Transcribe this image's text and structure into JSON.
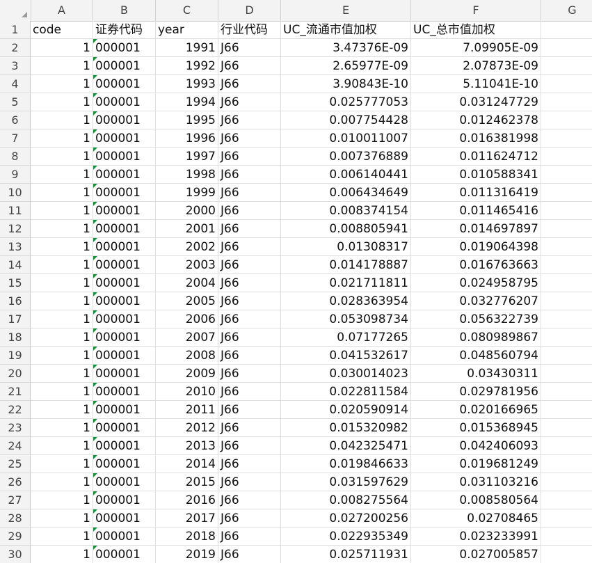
{
  "columns": [
    "A",
    "B",
    "C",
    "D",
    "E",
    "F",
    "G"
  ],
  "headers": [
    "code",
    "证券代码",
    "year",
    "行业代码",
    "UC_流通市值加权",
    "UC_总市值加权"
  ],
  "rows": [
    [
      "1",
      "000001",
      "1991",
      "J66",
      "3.47376E-09",
      "7.09905E-09"
    ],
    [
      "1",
      "000001",
      "1992",
      "J66",
      "2.65977E-09",
      "2.07873E-09"
    ],
    [
      "1",
      "000001",
      "1993",
      "J66",
      "3.90843E-10",
      "5.11041E-10"
    ],
    [
      "1",
      "000001",
      "1994",
      "J66",
      "0.025777053",
      "0.031247729"
    ],
    [
      "1",
      "000001",
      "1995",
      "J66",
      "0.007754428",
      "0.012462378"
    ],
    [
      "1",
      "000001",
      "1996",
      "J66",
      "0.010011007",
      "0.016381998"
    ],
    [
      "1",
      "000001",
      "1997",
      "J66",
      "0.007376889",
      "0.011624712"
    ],
    [
      "1",
      "000001",
      "1998",
      "J66",
      "0.006140441",
      "0.010588341"
    ],
    [
      "1",
      "000001",
      "1999",
      "J66",
      "0.006434649",
      "0.011316419"
    ],
    [
      "1",
      "000001",
      "2000",
      "J66",
      "0.008374154",
      "0.011465416"
    ],
    [
      "1",
      "000001",
      "2001",
      "J66",
      "0.008805941",
      "0.014697897"
    ],
    [
      "1",
      "000001",
      "2002",
      "J66",
      "0.01308317",
      "0.019064398"
    ],
    [
      "1",
      "000001",
      "2003",
      "J66",
      "0.014178887",
      "0.016763663"
    ],
    [
      "1",
      "000001",
      "2004",
      "J66",
      "0.021711811",
      "0.024958795"
    ],
    [
      "1",
      "000001",
      "2005",
      "J66",
      "0.028363954",
      "0.032776207"
    ],
    [
      "1",
      "000001",
      "2006",
      "J66",
      "0.053098734",
      "0.056322739"
    ],
    [
      "1",
      "000001",
      "2007",
      "J66",
      "0.07177265",
      "0.080989867"
    ],
    [
      "1",
      "000001",
      "2008",
      "J66",
      "0.041532617",
      "0.048560794"
    ],
    [
      "1",
      "000001",
      "2009",
      "J66",
      "0.030014023",
      "0.03430311"
    ],
    [
      "1",
      "000001",
      "2010",
      "J66",
      "0.022811584",
      "0.029781956"
    ],
    [
      "1",
      "000001",
      "2011",
      "J66",
      "0.020590914",
      "0.020166965"
    ],
    [
      "1",
      "000001",
      "2012",
      "J66",
      "0.015320982",
      "0.015368945"
    ],
    [
      "1",
      "000001",
      "2013",
      "J66",
      "0.042325471",
      "0.042406093"
    ],
    [
      "1",
      "000001",
      "2014",
      "J66",
      "0.019846633",
      "0.019681249"
    ],
    [
      "1",
      "000001",
      "2015",
      "J66",
      "0.031597629",
      "0.031103216"
    ],
    [
      "1",
      "000001",
      "2016",
      "J66",
      "0.008275564",
      "0.008580564"
    ],
    [
      "1",
      "000001",
      "2017",
      "J66",
      "0.027200256",
      "0.02708465"
    ],
    [
      "1",
      "000001",
      "2018",
      "J66",
      "0.022935349",
      "0.023233991"
    ],
    [
      "1",
      "000001",
      "2019",
      "J66",
      "0.025711931",
      "0.027005857"
    ]
  ],
  "colors": {
    "text_marker": "#1a8f3c",
    "header_bg": "#f3f3f3",
    "grid": "#dedede"
  }
}
